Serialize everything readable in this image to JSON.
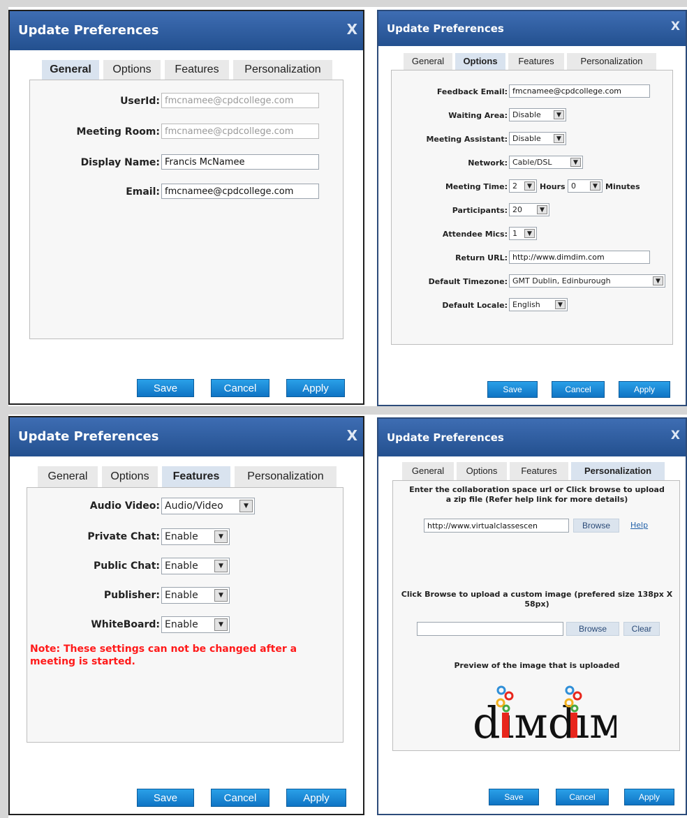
{
  "common": {
    "dialog_title": "Update Preferences",
    "close_glyph": "X",
    "tabs": [
      "General",
      "Options",
      "Features",
      "Personalization"
    ],
    "buttons": {
      "save": "Save",
      "cancel": "Cancel",
      "apply": "Apply"
    },
    "select_arrow": "▼"
  },
  "general": {
    "userid_label": "UserId:",
    "userid_value": "fmcnamee@cpdcollege.com",
    "room_label": "Meeting Room:",
    "room_value": "fmcnamee@cpdcollege.com",
    "display_label": "Display Name:",
    "display_value": "Francis McNamee",
    "email_label": "Email:",
    "email_value": "fmcnamee@cpdcollege.com"
  },
  "options": {
    "feedback_label": "Feedback Email:",
    "feedback_value": "fmcnamee@cpdcollege.com",
    "waiting_label": "Waiting Area:",
    "waiting_value": "Disable",
    "assistant_label": "Meeting Assistant:",
    "assistant_value": "Disable",
    "network_label": "Network:",
    "network_value": "Cable/DSL",
    "time_label": "Meeting Time:",
    "hours_value": "2",
    "hours_label": "Hours",
    "minutes_value": "0",
    "minutes_label": "Minutes",
    "participants_label": "Participants:",
    "participants_value": "20",
    "mics_label": "Attendee Mics:",
    "mics_value": "1",
    "return_label": "Return URL:",
    "return_value": "http://www.dimdim.com",
    "timezone_label": "Default Timezone:",
    "timezone_value": "GMT Dublin, Edinburough",
    "locale_label": "Default Locale:",
    "locale_value": "English"
  },
  "features": {
    "av_label": "Audio Video:",
    "av_value": "Audio/Video",
    "private_label": "Private Chat:",
    "private_value": "Enable",
    "public_label": "Public Chat:",
    "public_value": "Enable",
    "publisher_label": "Publisher:",
    "publisher_value": "Enable",
    "wb_label": "WhiteBoard:",
    "wb_value": "Enable",
    "note": "Note: These settings can not be changed after a meeting is started."
  },
  "personalization": {
    "intro": "Enter the collaboration space url or Click browse to upload a zip file (Refer help link for more details)",
    "url_value": "http://www.virtualclassescen",
    "browse": "Browse",
    "help": "Help",
    "image_text": "Click Browse to upload a custom image (prefered size 138px X 58px)",
    "image_value": "",
    "clear": "Clear",
    "preview_text": "Preview of the image that is uploaded",
    "logo_text": "dimdim"
  },
  "colors": {
    "titlebar": "#2f5d9e",
    "button": "#1a8ad6",
    "note": "#ff1a1a",
    "selected_tab": "#d9e3ef"
  }
}
